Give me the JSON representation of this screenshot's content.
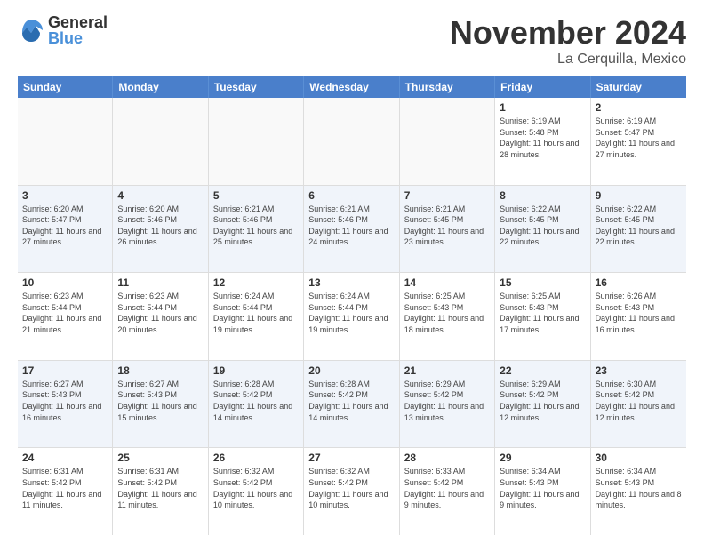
{
  "header": {
    "logo_general": "General",
    "logo_blue": "Blue",
    "month_title": "November 2024",
    "location": "La Cerquilla, Mexico"
  },
  "days_of_week": [
    "Sunday",
    "Monday",
    "Tuesday",
    "Wednesday",
    "Thursday",
    "Friday",
    "Saturday"
  ],
  "rows": [
    [
      {
        "day": "",
        "text": "",
        "empty": true
      },
      {
        "day": "",
        "text": "",
        "empty": true
      },
      {
        "day": "",
        "text": "",
        "empty": true
      },
      {
        "day": "",
        "text": "",
        "empty": true
      },
      {
        "day": "",
        "text": "",
        "empty": true
      },
      {
        "day": "1",
        "text": "Sunrise: 6:19 AM\nSunset: 5:48 PM\nDaylight: 11 hours and 28 minutes.",
        "empty": false
      },
      {
        "day": "2",
        "text": "Sunrise: 6:19 AM\nSunset: 5:47 PM\nDaylight: 11 hours and 27 minutes.",
        "empty": false
      }
    ],
    [
      {
        "day": "3",
        "text": "Sunrise: 6:20 AM\nSunset: 5:47 PM\nDaylight: 11 hours and 27 minutes.",
        "empty": false
      },
      {
        "day": "4",
        "text": "Sunrise: 6:20 AM\nSunset: 5:46 PM\nDaylight: 11 hours and 26 minutes.",
        "empty": false
      },
      {
        "day": "5",
        "text": "Sunrise: 6:21 AM\nSunset: 5:46 PM\nDaylight: 11 hours and 25 minutes.",
        "empty": false
      },
      {
        "day": "6",
        "text": "Sunrise: 6:21 AM\nSunset: 5:46 PM\nDaylight: 11 hours and 24 minutes.",
        "empty": false
      },
      {
        "day": "7",
        "text": "Sunrise: 6:21 AM\nSunset: 5:45 PM\nDaylight: 11 hours and 23 minutes.",
        "empty": false
      },
      {
        "day": "8",
        "text": "Sunrise: 6:22 AM\nSunset: 5:45 PM\nDaylight: 11 hours and 22 minutes.",
        "empty": false
      },
      {
        "day": "9",
        "text": "Sunrise: 6:22 AM\nSunset: 5:45 PM\nDaylight: 11 hours and 22 minutes.",
        "empty": false
      }
    ],
    [
      {
        "day": "10",
        "text": "Sunrise: 6:23 AM\nSunset: 5:44 PM\nDaylight: 11 hours and 21 minutes.",
        "empty": false
      },
      {
        "day": "11",
        "text": "Sunrise: 6:23 AM\nSunset: 5:44 PM\nDaylight: 11 hours and 20 minutes.",
        "empty": false
      },
      {
        "day": "12",
        "text": "Sunrise: 6:24 AM\nSunset: 5:44 PM\nDaylight: 11 hours and 19 minutes.",
        "empty": false
      },
      {
        "day": "13",
        "text": "Sunrise: 6:24 AM\nSunset: 5:44 PM\nDaylight: 11 hours and 19 minutes.",
        "empty": false
      },
      {
        "day": "14",
        "text": "Sunrise: 6:25 AM\nSunset: 5:43 PM\nDaylight: 11 hours and 18 minutes.",
        "empty": false
      },
      {
        "day": "15",
        "text": "Sunrise: 6:25 AM\nSunset: 5:43 PM\nDaylight: 11 hours and 17 minutes.",
        "empty": false
      },
      {
        "day": "16",
        "text": "Sunrise: 6:26 AM\nSunset: 5:43 PM\nDaylight: 11 hours and 16 minutes.",
        "empty": false
      }
    ],
    [
      {
        "day": "17",
        "text": "Sunrise: 6:27 AM\nSunset: 5:43 PM\nDaylight: 11 hours and 16 minutes.",
        "empty": false
      },
      {
        "day": "18",
        "text": "Sunrise: 6:27 AM\nSunset: 5:43 PM\nDaylight: 11 hours and 15 minutes.",
        "empty": false
      },
      {
        "day": "19",
        "text": "Sunrise: 6:28 AM\nSunset: 5:42 PM\nDaylight: 11 hours and 14 minutes.",
        "empty": false
      },
      {
        "day": "20",
        "text": "Sunrise: 6:28 AM\nSunset: 5:42 PM\nDaylight: 11 hours and 14 minutes.",
        "empty": false
      },
      {
        "day": "21",
        "text": "Sunrise: 6:29 AM\nSunset: 5:42 PM\nDaylight: 11 hours and 13 minutes.",
        "empty": false
      },
      {
        "day": "22",
        "text": "Sunrise: 6:29 AM\nSunset: 5:42 PM\nDaylight: 11 hours and 12 minutes.",
        "empty": false
      },
      {
        "day": "23",
        "text": "Sunrise: 6:30 AM\nSunset: 5:42 PM\nDaylight: 11 hours and 12 minutes.",
        "empty": false
      }
    ],
    [
      {
        "day": "24",
        "text": "Sunrise: 6:31 AM\nSunset: 5:42 PM\nDaylight: 11 hours and 11 minutes.",
        "empty": false
      },
      {
        "day": "25",
        "text": "Sunrise: 6:31 AM\nSunset: 5:42 PM\nDaylight: 11 hours and 11 minutes.",
        "empty": false
      },
      {
        "day": "26",
        "text": "Sunrise: 6:32 AM\nSunset: 5:42 PM\nDaylight: 11 hours and 10 minutes.",
        "empty": false
      },
      {
        "day": "27",
        "text": "Sunrise: 6:32 AM\nSunset: 5:42 PM\nDaylight: 11 hours and 10 minutes.",
        "empty": false
      },
      {
        "day": "28",
        "text": "Sunrise: 6:33 AM\nSunset: 5:42 PM\nDaylight: 11 hours and 9 minutes.",
        "empty": false
      },
      {
        "day": "29",
        "text": "Sunrise: 6:34 AM\nSunset: 5:43 PM\nDaylight: 11 hours and 9 minutes.",
        "empty": false
      },
      {
        "day": "30",
        "text": "Sunrise: 6:34 AM\nSunset: 5:43 PM\nDaylight: 11 hours and 8 minutes.",
        "empty": false
      }
    ]
  ]
}
